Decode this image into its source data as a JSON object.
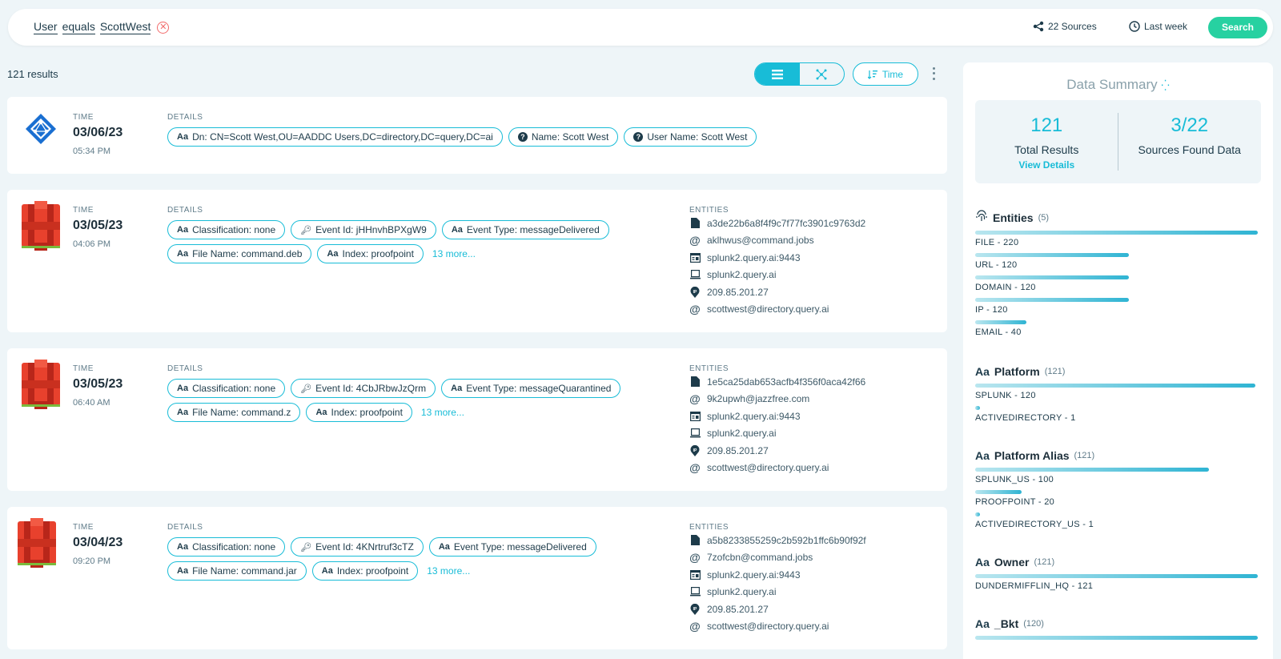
{
  "search": {
    "query_tokens": [
      "User",
      "equals",
      "ScottWest"
    ],
    "sources_label": "22 Sources",
    "time_label": "Last week",
    "search_label": "Search"
  },
  "results": {
    "count_label": "121 results",
    "sort_label": "Time"
  },
  "cards": [
    {
      "icon": "azure-ad-icon",
      "time_label": "TIME",
      "date": "03/06/23",
      "time": "05:34 PM",
      "details_label": "DETAILS",
      "chips": [
        {
          "type": "text",
          "text": "Dn: CN=Scott West,OU=AADDC Users,DC=directory,DC=query,DC=ai"
        },
        {
          "type": "help",
          "text": "Name: Scott West"
        },
        {
          "type": "help",
          "text": "User Name: Scott West"
        }
      ],
      "more": ""
    },
    {
      "icon": "aws-s3-icon",
      "time_label": "TIME",
      "date": "03/05/23",
      "time": "04:06 PM",
      "details_label": "DETAILS",
      "chips": [
        {
          "type": "text",
          "text": "Classification: none"
        },
        {
          "type": "key",
          "text": "Event Id: jHHnvhBPXgW9"
        },
        {
          "type": "text",
          "text": "Event Type: messageDelivered"
        },
        {
          "type": "text",
          "text": "File Name: command.deb"
        },
        {
          "type": "text",
          "text": "Index: proofpoint"
        }
      ],
      "more": "13 more...",
      "entities_label": "ENTITIES",
      "entities": [
        {
          "icon": "file-icon",
          "text": "a3de22b6a8f4f9c7f77fc3901c9763d2"
        },
        {
          "icon": "email-icon",
          "text": "aklhwus@command.jobs"
        },
        {
          "icon": "url-icon",
          "text": "splunk2.query.ai:9443"
        },
        {
          "icon": "domain-icon",
          "text": "splunk2.query.ai"
        },
        {
          "icon": "ip-icon",
          "text": "209.85.201.27"
        },
        {
          "icon": "email-icon",
          "text": "scottwest@directory.query.ai"
        }
      ]
    },
    {
      "icon": "aws-s3-icon",
      "time_label": "TIME",
      "date": "03/05/23",
      "time": "06:40 AM",
      "details_label": "DETAILS",
      "chips": [
        {
          "type": "text",
          "text": "Classification: none"
        },
        {
          "type": "key",
          "text": "Event Id: 4CbJRbwJzQrm"
        },
        {
          "type": "text",
          "text": "Event Type: messageQuarantined"
        },
        {
          "type": "text",
          "text": "File Name: command.z"
        },
        {
          "type": "text",
          "text": "Index: proofpoint"
        }
      ],
      "more": "13 more...",
      "entities_label": "ENTITIES",
      "entities": [
        {
          "icon": "file-icon",
          "text": "1e5ca25dab653acfb4f356f0aca42f66"
        },
        {
          "icon": "email-icon",
          "text": "9k2upwh@jazzfree.com"
        },
        {
          "icon": "url-icon",
          "text": "splunk2.query.ai:9443"
        },
        {
          "icon": "domain-icon",
          "text": "splunk2.query.ai"
        },
        {
          "icon": "ip-icon",
          "text": "209.85.201.27"
        },
        {
          "icon": "email-icon",
          "text": "scottwest@directory.query.ai"
        }
      ]
    },
    {
      "icon": "aws-s3-icon",
      "time_label": "TIME",
      "date": "03/04/23",
      "time": "09:20 PM",
      "details_label": "DETAILS",
      "chips": [
        {
          "type": "text",
          "text": "Classification: none"
        },
        {
          "type": "key",
          "text": "Event Id: 4KNrtruf3cTZ"
        },
        {
          "type": "text",
          "text": "Event Type: messageDelivered"
        },
        {
          "type": "text",
          "text": "File Name: command.jar"
        },
        {
          "type": "text",
          "text": "Index: proofpoint"
        }
      ],
      "more": "13 more...",
      "entities_label": "ENTITIES",
      "entities": [
        {
          "icon": "file-icon",
          "text": "a5b8233855259c2b592b1ffc6b90f92f"
        },
        {
          "icon": "email-icon",
          "text": "7zofcbn@command.jobs"
        },
        {
          "icon": "url-icon",
          "text": "splunk2.query.ai:9443"
        },
        {
          "icon": "domain-icon",
          "text": "splunk2.query.ai"
        },
        {
          "icon": "ip-icon",
          "text": "209.85.201.27"
        },
        {
          "icon": "email-icon",
          "text": "scottwest@directory.query.ai"
        }
      ]
    }
  ],
  "summary": {
    "title": "Data Summary",
    "total_results": "121",
    "total_results_label": "Total Results",
    "view_details": "View Details",
    "sources_found": "3/22",
    "sources_found_label": "Sources Found Data",
    "facets": [
      {
        "icon": "fingerprint-icon",
        "name": "Entities",
        "count": "(5)",
        "items": [
          {
            "label": "FILE - 220",
            "fraction": 1.0
          },
          {
            "label": "URL - 120",
            "fraction": 0.545
          },
          {
            "label": "DOMAIN - 120",
            "fraction": 0.545
          },
          {
            "label": "IP - 120",
            "fraction": 0.545
          },
          {
            "label": "EMAIL - 40",
            "fraction": 0.182
          }
        ]
      },
      {
        "icon": "text-aa-icon",
        "name": "Platform",
        "count": "(121)",
        "items": [
          {
            "label": "SPLUNK - 120",
            "fraction": 0.992
          },
          {
            "label": "ACTIVEDIRECTORY - 1",
            "fraction": 0.008
          }
        ]
      },
      {
        "icon": "text-aa-icon",
        "name": "Platform Alias",
        "count": "(121)",
        "items": [
          {
            "label": "SPLUNK_US - 100",
            "fraction": 0.826
          },
          {
            "label": "PROOFPOINT - 20",
            "fraction": 0.165
          },
          {
            "label": "ACTIVEDIRECTORY_US - 1",
            "fraction": 0.008
          }
        ]
      },
      {
        "icon": "text-aa-icon",
        "name": "Owner",
        "count": "(121)",
        "items": [
          {
            "label": "DUNDERMIFFLIN_HQ - 121",
            "fraction": 1.0
          }
        ]
      },
      {
        "icon": "text-aa-icon",
        "name": "_Bkt",
        "count": "(120)",
        "items": []
      }
    ]
  }
}
